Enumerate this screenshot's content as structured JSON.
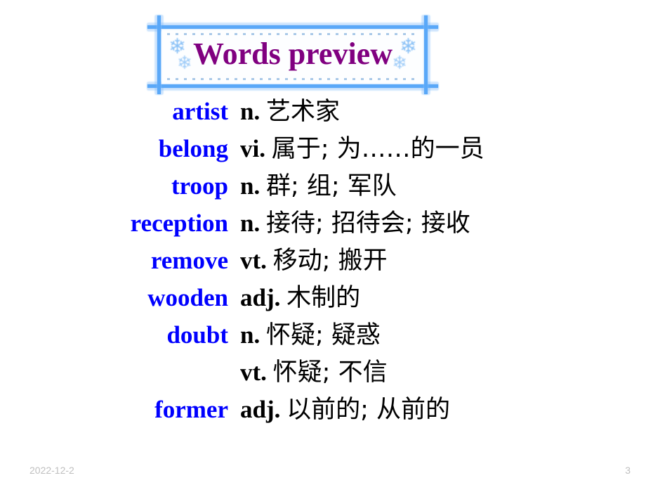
{
  "slide": {
    "title": "Words preview",
    "title_color": "#800080",
    "word_color": "#0000FF",
    "definition_color": "#000000",
    "frame_color": "#5AA8F8",
    "background_color": "#FFFFFF",
    "decoration_icon": "snowflake-icon"
  },
  "words": [
    {
      "en": "artist",
      "pos": "n.",
      "zh": "艺术家"
    },
    {
      "en": "belong",
      "pos": "vi.",
      "zh": "属于; 为……的一员"
    },
    {
      "en": "troop",
      "pos": "n.",
      "zh": "群; 组; 军队"
    },
    {
      "en": "reception",
      "pos": "n.",
      "zh": "接待; 招待会; 接收"
    },
    {
      "en": "remove",
      "pos": "vt.",
      "zh": "移动; 搬开"
    },
    {
      "en": "wooden",
      "pos": "adj.",
      "zh": "木制的"
    },
    {
      "en": "doubt",
      "pos": "n.",
      "zh": "怀疑; 疑惑"
    },
    {
      "en": "",
      "pos": "vt.",
      "zh": "怀疑; 不信"
    },
    {
      "en": "former",
      "pos": "adj.",
      "zh": "以前的; 从前的"
    }
  ],
  "footer": {
    "date": "2022-12-2",
    "page_number": "3"
  }
}
